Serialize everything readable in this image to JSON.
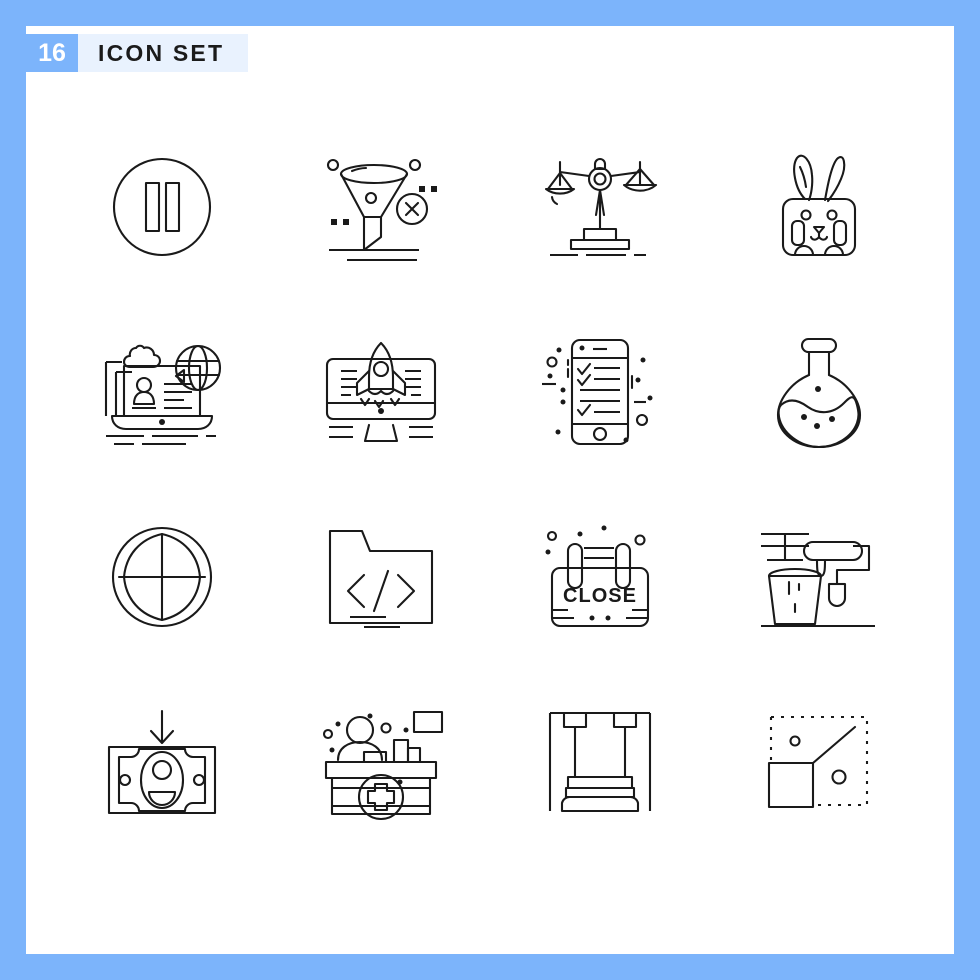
{
  "page": {
    "border_color": "#7CB4FB",
    "background_color": "#FFFFFF"
  },
  "header": {
    "count": "16",
    "title": "ICON SET",
    "count_bg": "#7CB4FB",
    "count_fg": "#FFFFFF",
    "title_bg": "#E9F2FE",
    "title_fg": "#1B1B1B"
  },
  "grid": {
    "columns": 4,
    "rows": 4,
    "stroke_color": "#1A1A1A",
    "style": "outline",
    "icons": [
      {
        "index": 1,
        "name": "pause-circle-icon",
        "label": "Pause"
      },
      {
        "index": 2,
        "name": "funnel-remove-icon",
        "label": "Filter Remove"
      },
      {
        "index": 3,
        "name": "justice-scales-icon",
        "label": "Balance Scales"
      },
      {
        "index": 4,
        "name": "rabbit-icon",
        "label": "Rabbit"
      },
      {
        "index": 5,
        "name": "online-learning-icon",
        "label": "Online Learning"
      },
      {
        "index": 6,
        "name": "rocket-monitor-icon",
        "label": "Startup Launch"
      },
      {
        "index": 7,
        "name": "mobile-checklist-icon",
        "label": "Mobile Checklist"
      },
      {
        "index": 8,
        "name": "flask-icon",
        "label": "Chemistry Flask"
      },
      {
        "index": 9,
        "name": "globe-grid-icon",
        "label": "Globe Grid"
      },
      {
        "index": 10,
        "name": "code-folder-icon",
        "label": "Code Folder"
      },
      {
        "index": 11,
        "name": "close-sign-icon",
        "label": "Close Sign",
        "sign_text": "CLOSE"
      },
      {
        "index": 12,
        "name": "paint-roller-icon",
        "label": "Paint Roller"
      },
      {
        "index": 13,
        "name": "money-deposit-icon",
        "label": "Money Deposit"
      },
      {
        "index": 14,
        "name": "reception-desk-icon",
        "label": "Hospital Reception"
      },
      {
        "index": 15,
        "name": "press-machine-icon",
        "label": "Press Machine"
      },
      {
        "index": 16,
        "name": "scale-resize-icon",
        "label": "Scale Resize"
      }
    ]
  }
}
